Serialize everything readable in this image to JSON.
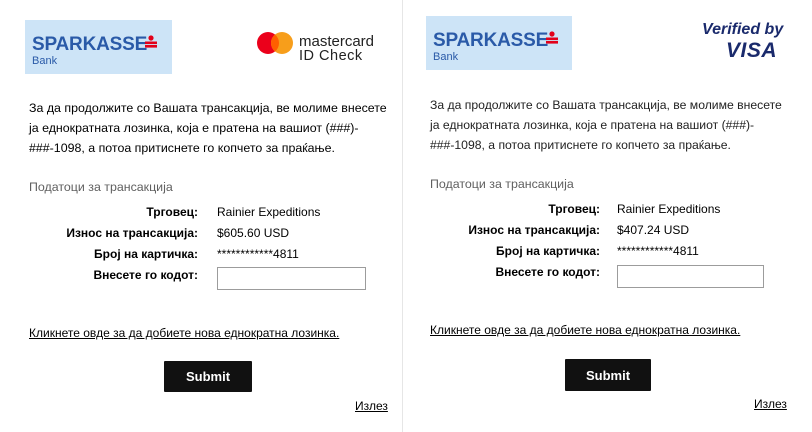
{
  "bank": {
    "name": "SPARKASSE",
    "sub": "Bank"
  },
  "instructions": {
    "line1": "За да продолжите со Вашата трансакција, ве молиме внесете",
    "line2": "ја еднократната лозинка, која е пратена на вашиот (###)-",
    "line3": "###-1098, а потоа притиснете го копчето за праќање."
  },
  "section_title": "Податоци за трансакција",
  "labels": {
    "merchant": "Трговец:",
    "amount": "Износ на трансакција:",
    "card": "Број на картичка:",
    "code": "Внесете го кодот:"
  },
  "left": {
    "brand_top": "mastercard",
    "brand_bottom": "ID Check",
    "merchant": "Rainier Expeditions",
    "amount": "$605.60 USD",
    "card": "************4811",
    "code_value": ""
  },
  "right": {
    "brand_top": "Verified by",
    "brand_bottom": "VISA",
    "merchant": "Rainier Expeditions",
    "amount": "$407.24 USD",
    "card": "************4811",
    "code_value": ""
  },
  "new_code_link": "Кликнете овде за да добиете нова еднократна лозинка.",
  "submit_label": "Submit",
  "exit_label": "Излез",
  "colors": {
    "bank_bg": "#cde4f7",
    "bank_text": "#2a5aa8",
    "sparkasse_red": "#e2001a",
    "mc_red": "#eb001b",
    "mc_orange": "#f79e1b",
    "visa_blue": "#1a2a6c",
    "button_bg": "#111111"
  }
}
